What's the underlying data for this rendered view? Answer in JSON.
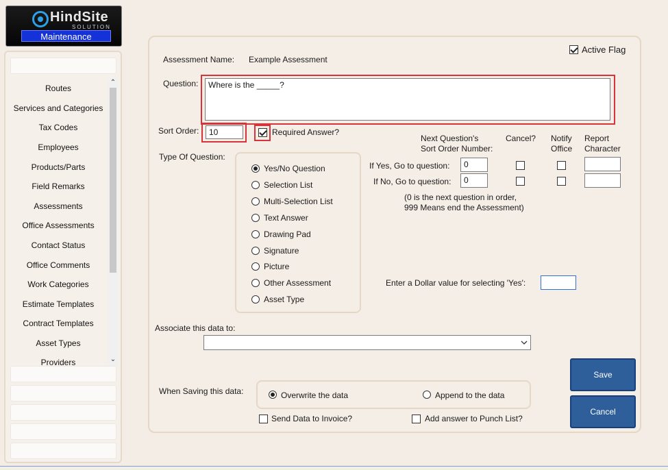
{
  "logo": {
    "brand": "HindSite",
    "sub": "SOLUTION",
    "section": "Maintenance"
  },
  "sidebar": {
    "items": [
      {
        "label": "Routes"
      },
      {
        "label": "Services and Categories"
      },
      {
        "label": "Tax Codes"
      },
      {
        "label": "Employees"
      },
      {
        "label": "Products/Parts"
      },
      {
        "label": "Field Remarks"
      },
      {
        "label": "Assessments"
      },
      {
        "label": "Office Assessments"
      },
      {
        "label": "Contact Status"
      },
      {
        "label": "Office Comments"
      },
      {
        "label": "Work Categories"
      },
      {
        "label": "Estimate Templates"
      },
      {
        "label": "Contract Templates"
      },
      {
        "label": "Asset Types"
      },
      {
        "label": "Providers"
      }
    ],
    "scroll_up": "⌃",
    "scroll_down": "⌄"
  },
  "form": {
    "active_flag_label": "Active Flag",
    "active_flag_checked": true,
    "assessment_name_label": "Assessment Name:",
    "assessment_name_value": "Example Assessment",
    "question_label": "Question:",
    "question_value": "Where is the _____?",
    "sort_order_label": "Sort Order:",
    "sort_order_value": "10",
    "required_answer_label": "Required Answer?",
    "required_answer_checked": true,
    "type_label": "Type Of Question:",
    "question_types": [
      {
        "label": "Yes/No Question",
        "selected": true
      },
      {
        "label": "Selection List",
        "selected": false
      },
      {
        "label": "Multi-Selection List",
        "selected": false
      },
      {
        "label": "Text Answer",
        "selected": false
      },
      {
        "label": "Drawing Pad",
        "selected": false
      },
      {
        "label": "Signature",
        "selected": false
      },
      {
        "label": "Picture",
        "selected": false
      },
      {
        "label": "Other Assessment",
        "selected": false
      },
      {
        "label": "Asset Type",
        "selected": false
      }
    ],
    "branching": {
      "header_next_line1": "Next Question's",
      "header_next_line2": "Sort Order Number:",
      "header_cancel": "Cancel?",
      "header_notify_line1": "Notify",
      "header_notify_line2": "Office",
      "header_report_line1": "Report",
      "header_report_line2": "Character",
      "if_yes_label": "If Yes, Go to question:",
      "if_yes_value": "0",
      "if_no_label": "If No, Go to question:",
      "if_no_value": "0",
      "note_line1": "(0 is the next question in order,",
      "note_line2": "999 Means end the Assessment)"
    },
    "dollar_label": "Enter a Dollar value for selecting 'Yes':",
    "dollar_value": "",
    "associate_label": "Associate this data to:",
    "associate_value": "",
    "saving_label": "When Saving this data:",
    "saving_options": [
      {
        "label": "Overwrite the data",
        "selected": true
      },
      {
        "label": "Append to the data",
        "selected": false
      }
    ],
    "send_invoice_label": "Send Data to Invoice?",
    "punch_list_label": "Add answer to Punch List?",
    "save_label": "Save",
    "cancel_label": "Cancel"
  }
}
